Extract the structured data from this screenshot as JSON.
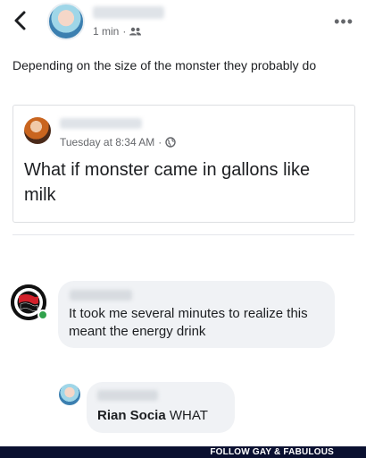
{
  "header": {
    "time": "1 min",
    "separator": "·",
    "audience_icon": "friends-icon",
    "back_icon": "chevron-left-icon",
    "more_icon": "more-options-icon",
    "more_label": "•••"
  },
  "post": {
    "text": "Depending on the size of the monster they probably do"
  },
  "shared_post": {
    "timestamp": "Tuesday at 8:34 AM",
    "separator": "·",
    "audience_icon": "globe-icon",
    "text": "What if monster came in gallons like milk"
  },
  "comments": [
    {
      "text": "It took me several minutes to realize this meant the energy drink"
    },
    {
      "mention": "Rian Socia",
      "text": " WHAT"
    }
  ],
  "footer": {
    "text": "FOLLOW GAY & FABULOUS"
  }
}
